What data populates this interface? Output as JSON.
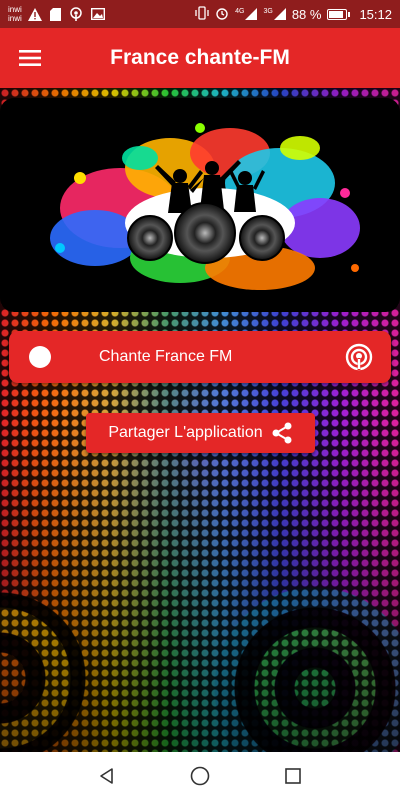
{
  "status_bar": {
    "carrier_1": "inwi",
    "carrier_2": "inwi",
    "signal_label_1": "4G",
    "signal_label_2": "3G",
    "battery_percent": "88 %",
    "battery_level": 0.88,
    "time": "15:12",
    "icons": [
      "warning-icon",
      "sd-card-icon",
      "podcast-icon",
      "image-icon",
      "vibrate-icon",
      "alarm-icon",
      "signal-icon",
      "battery-icon"
    ]
  },
  "app_bar": {
    "title": "France chante-FM",
    "menu_icon": "hamburger-menu-icon"
  },
  "banner": {
    "image": "dancers-speakers-paint-splash"
  },
  "player": {
    "station_name": "Chante France FM",
    "icon": "podcast-icon"
  },
  "share": {
    "label": "Partager L'application",
    "icon": "share-icon"
  },
  "nav_bar": {
    "icons": [
      "back-icon",
      "home-icon",
      "recents-icon"
    ]
  },
  "colors": {
    "accent": "#e42727",
    "status_bar": "#8f1d1d",
    "nav_bar": "#ffffff"
  }
}
